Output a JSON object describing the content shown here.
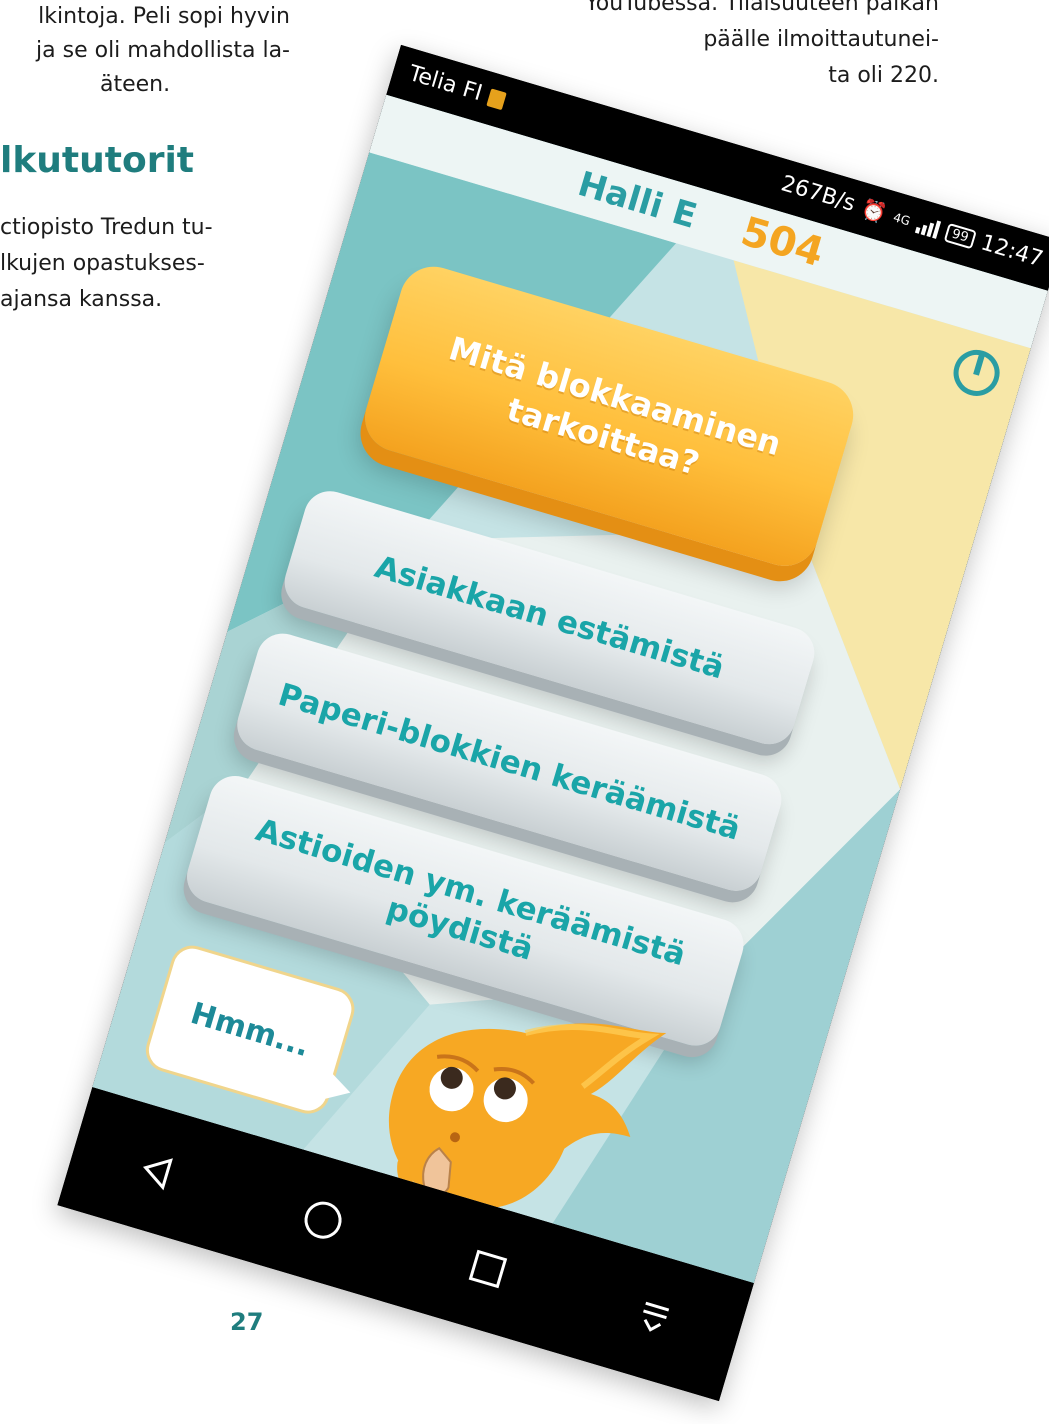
{
  "page": {
    "left_column_top_lines": [
      "lkintoja. Peli sopi hyvin",
      "ja se oli mahdollista la-",
      "äteen."
    ],
    "heading": "lkututorit",
    "left_column_lines": [
      "ctiopisto Tredun tu-",
      "lkujen opastukses-",
      "ajansa kanssa."
    ],
    "right_column_lines": [
      "YouTubessa. Tilaisuuteen paikan",
      "päälle ilmoittautunei-",
      "ta oli 220."
    ],
    "page_number": "27"
  },
  "phone": {
    "status_bar": {
      "carrier": "Telia FI",
      "network_speed": "267B/s",
      "network_type": "4G",
      "battery": "99",
      "time": "12:47"
    },
    "game": {
      "hall_label": "Halli E",
      "score": "504",
      "question": "Mitä blokkaaminen tarkoittaa?",
      "answers": [
        "Asiakkaan estämistä",
        "Paperi-blokkien keräämistä",
        "Astioiden ym. keräämistä pöydistä"
      ],
      "speech_bubble": "Hmm..."
    },
    "colors": {
      "accent_teal": "#1aa5a8",
      "question_orange": "#ffbf3c",
      "mascot_orange": "#f7a823",
      "page_heading": "#1f7d7e"
    },
    "icons": [
      "back-icon",
      "home-icon",
      "recents-icon",
      "notification-pull-icon",
      "power-icon",
      "alarm-icon"
    ]
  }
}
